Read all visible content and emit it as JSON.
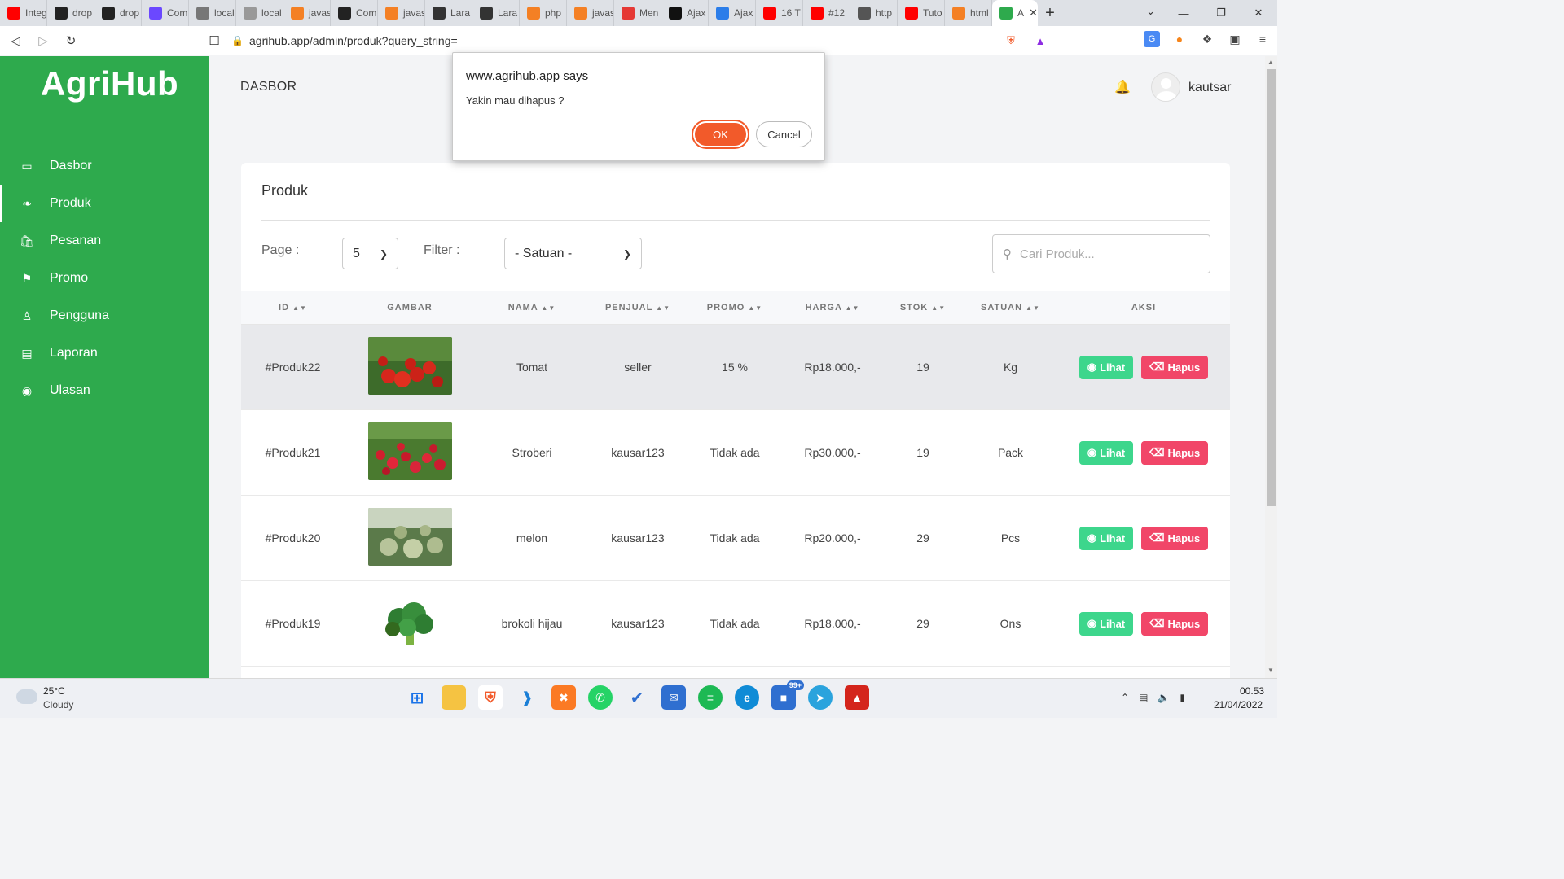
{
  "browser": {
    "tabs": [
      {
        "title": "Integ",
        "icon": "youtube-icon",
        "color": "#ff0000"
      },
      {
        "title": "drop",
        "icon": "github-icon",
        "color": "#222222"
      },
      {
        "title": "drop",
        "icon": "github-icon",
        "color": "#222222"
      },
      {
        "title": "Com",
        "icon": "app-icon",
        "color": "#6b48ff"
      },
      {
        "title": "local",
        "icon": "leaf-icon",
        "color": "#777777"
      },
      {
        "title": "local",
        "icon": "chart-icon",
        "color": "#999999"
      },
      {
        "title": "javas",
        "icon": "code-icon",
        "color": "#f48024"
      },
      {
        "title": "Com",
        "icon": "github-icon",
        "color": "#222222"
      },
      {
        "title": "javas",
        "icon": "stackoverflow-icon",
        "color": "#f48024"
      },
      {
        "title": "Lara",
        "icon": "tm-icon",
        "color": "#333333"
      },
      {
        "title": "Lara",
        "icon": "tm-icon",
        "color": "#333333"
      },
      {
        "title": "php",
        "icon": "stackoverflow-icon",
        "color": "#f48024"
      },
      {
        "title": "javas",
        "icon": "stackoverflow-icon",
        "color": "#f48024"
      },
      {
        "title": "Men",
        "icon": "qa-icon",
        "color": "#e53935"
      },
      {
        "title": "Ajax",
        "icon": "dark-circle-icon",
        "color": "#111111"
      },
      {
        "title": "Ajax",
        "icon": "st-icon",
        "color": "#2b7de9"
      },
      {
        "title": "16 T",
        "icon": "youtube-icon",
        "color": "#ff0000"
      },
      {
        "title": "#12",
        "icon": "youtube-icon",
        "color": "#ff0000"
      },
      {
        "title": "http",
        "icon": "grid-icon",
        "color": "#555555"
      },
      {
        "title": "Tuto",
        "icon": "youtube-icon",
        "color": "#ff0000"
      },
      {
        "title": "html",
        "icon": "stackoverflow-icon",
        "color": "#f48024"
      }
    ],
    "active_tab": {
      "title": "A",
      "icon": "leaf-icon",
      "color": "#2eaa4d"
    },
    "url": "agrihub.app/admin/produk?query_string="
  },
  "sidebar": {
    "logo": "AgriHub",
    "items": [
      {
        "label": "Dasbor",
        "icon": "monitor-icon"
      },
      {
        "label": "Produk",
        "icon": "leaf-icon"
      },
      {
        "label": "Pesanan",
        "icon": "shopping-bag-icon"
      },
      {
        "label": "Promo",
        "icon": "tag-icon"
      },
      {
        "label": "Pengguna",
        "icon": "user-icon"
      },
      {
        "label": "Laporan",
        "icon": "report-icon"
      },
      {
        "label": "Ulasan",
        "icon": "chat-icon"
      }
    ],
    "active": "Produk"
  },
  "header": {
    "title": "DASBOR",
    "username": "kautsar"
  },
  "card": {
    "title": "Produk",
    "page_label": "Page :",
    "page_value": "5",
    "filter_label": "Filter :",
    "filter_value": "- Satuan -",
    "search_placeholder": "Cari Produk..."
  },
  "table": {
    "columns": [
      "ID",
      "GAMBAR",
      "NAMA",
      "PENJUAL",
      "PROMO",
      "HARGA",
      "STOK",
      "SATUAN",
      "AKSI"
    ],
    "rows": [
      {
        "id": "#Produk22",
        "image": "tomato",
        "nama": "Tomat",
        "penjual": "seller",
        "promo": "15 %",
        "harga": "Rp18.000,-",
        "stok": "19",
        "satuan": "Kg"
      },
      {
        "id": "#Produk21",
        "image": "strawberry",
        "nama": "Stroberi",
        "penjual": "kausar123",
        "promo": "Tidak ada",
        "harga": "Rp30.000,-",
        "stok": "19",
        "satuan": "Pack"
      },
      {
        "id": "#Produk20",
        "image": "melon",
        "nama": "melon",
        "penjual": "kausar123",
        "promo": "Tidak ada",
        "harga": "Rp20.000,-",
        "stok": "29",
        "satuan": "Pcs"
      },
      {
        "id": "#Produk19",
        "image": "broccoli",
        "nama": "brokoli hijau",
        "penjual": "kausar123",
        "promo": "Tidak ada",
        "harga": "Rp18.000,-",
        "stok": "29",
        "satuan": "Ons"
      }
    ],
    "view_label": "Lihat",
    "delete_label": "Hapus"
  },
  "dialog": {
    "title": "www.agrihub.app says",
    "message": "Yakin mau dihapus ?",
    "ok_label": "OK",
    "cancel_label": "Cancel"
  },
  "taskbar": {
    "weather_temp": "25°C",
    "weather_desc": "Cloudy",
    "time": "00.53",
    "date": "21/04/2022",
    "badge": "99+"
  },
  "colors": {
    "brand_green": "#2eaa4d",
    "view_button": "#3dd68c",
    "delete_button": "#f14668",
    "ok_button": "#f25a2a"
  }
}
